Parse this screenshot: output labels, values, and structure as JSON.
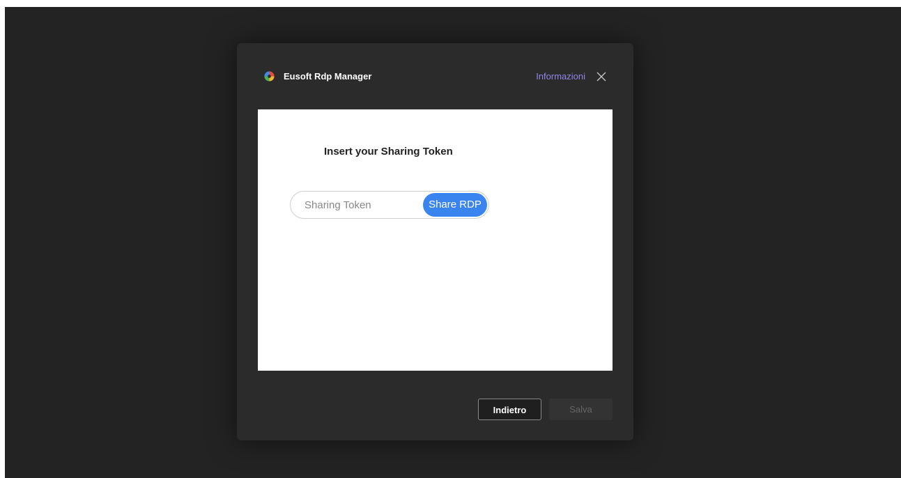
{
  "window": {
    "app_title": "Eusoft Rdp Manager",
    "info_link": "Informazioni",
    "logo_icon": "eusoft-logo-icon",
    "close_icon": "close-icon"
  },
  "content": {
    "heading": "Insert your Sharing Token",
    "token_placeholder": "Sharing Token",
    "token_value": "",
    "share_button": "Share RDP"
  },
  "footer": {
    "back_label": "Indietro",
    "save_label": "Salva",
    "save_enabled": false
  },
  "colors": {
    "backdrop": "#232323",
    "dialog": "#2b2b2b",
    "accent_link": "#8f86e8",
    "primary_button": "#3a84f0"
  }
}
